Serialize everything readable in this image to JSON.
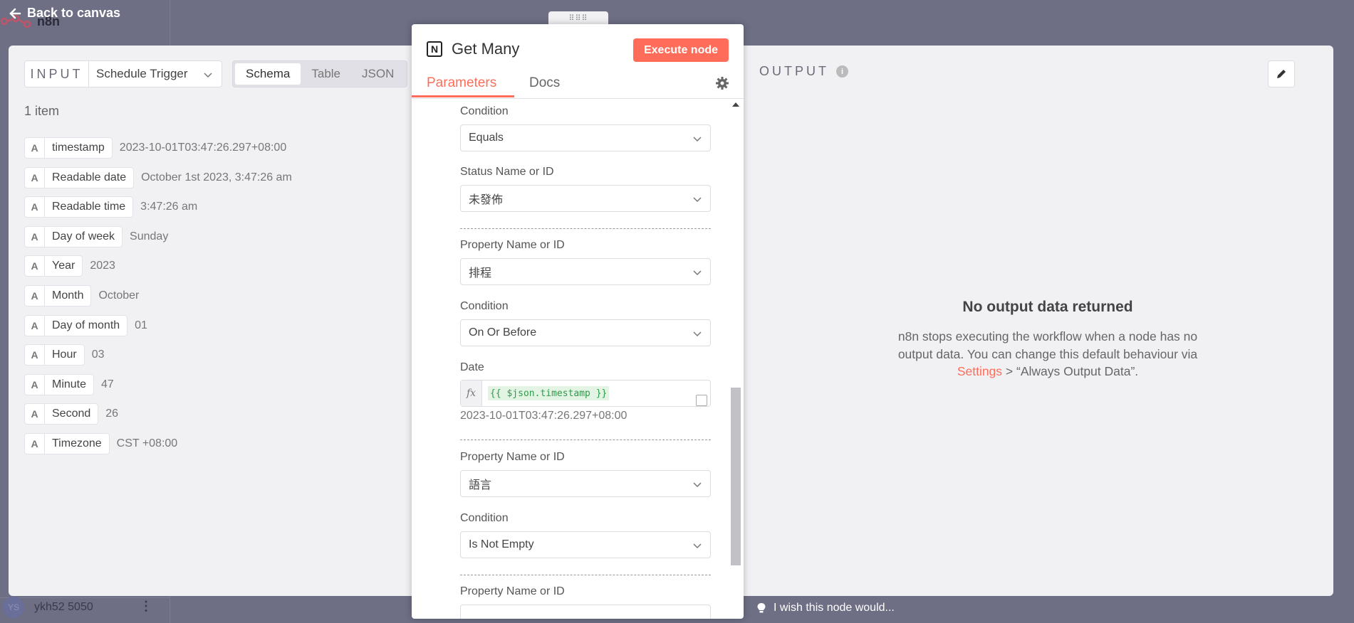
{
  "background": {
    "app_name": "n8n",
    "user": {
      "initials": "YS",
      "name": "ykh52 5050"
    }
  },
  "nav": {
    "back_label": "Back to canvas"
  },
  "input_panel": {
    "title": "INPUT",
    "source_select": "Schedule Trigger",
    "view_tabs": [
      "Schema",
      "Table",
      "JSON"
    ],
    "active_tab": "Schema",
    "item_count": "1 item",
    "fields": [
      {
        "type": "A",
        "key": "timestamp",
        "value": "2023-10-01T03:47:26.297+08:00"
      },
      {
        "type": "A",
        "key": "Readable date",
        "value": "October 1st 2023, 3:47:26 am"
      },
      {
        "type": "A",
        "key": "Readable time",
        "value": "3:47:26 am"
      },
      {
        "type": "A",
        "key": "Day of week",
        "value": "Sunday"
      },
      {
        "type": "A",
        "key": "Year",
        "value": "2023"
      },
      {
        "type": "A",
        "key": "Month",
        "value": "October"
      },
      {
        "type": "A",
        "key": "Day of month",
        "value": "01"
      },
      {
        "type": "A",
        "key": "Hour",
        "value": "03"
      },
      {
        "type": "A",
        "key": "Minute",
        "value": "47"
      },
      {
        "type": "A",
        "key": "Second",
        "value": "26"
      },
      {
        "type": "A",
        "key": "Timezone",
        "value": "CST +08:00"
      }
    ]
  },
  "node_panel": {
    "icon_letter": "N",
    "title": "Get Many",
    "execute_label": "Execute node",
    "tabs": [
      "Parameters",
      "Docs"
    ],
    "params": {
      "condition_1_label": "Condition",
      "condition_1_value": "Equals",
      "status_label": "Status Name or ID",
      "status_value": "未發佈",
      "property_1_label": "Property Name or ID",
      "property_1_value": "排程",
      "condition_2_label": "Condition",
      "condition_2_value": "On Or Before",
      "date_label": "Date",
      "date_fx": "fx",
      "date_expression": "{{ $json.timestamp }}",
      "date_result": "2023-10-01T03:47:26.297+08:00",
      "property_2_label": "Property Name or ID",
      "property_2_value": "語言",
      "condition_3_label": "Condition",
      "condition_3_value": "Is Not Empty",
      "property_3_label": "Property Name or ID"
    }
  },
  "output_panel": {
    "title": "OUTPUT",
    "empty_title": "No output data returned",
    "empty_text_before": "n8n stops executing the workflow when a node has no output data. You can change this default behaviour via ",
    "empty_link": "Settings",
    "empty_text_after": " > “Always Output Data”."
  },
  "feedback": {
    "label": "I wish this node would..."
  },
  "colors": {
    "accent": "#ff6d5a",
    "backdrop": "#6e6e84",
    "panel": "#f1f1f4"
  }
}
